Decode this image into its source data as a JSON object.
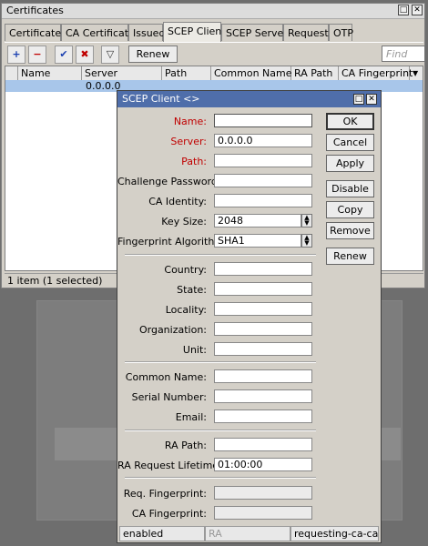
{
  "window": {
    "title": "Certificates",
    "tabs": [
      "Certificates",
      "CA Certificates",
      "Issued",
      "SCEP Clients",
      "SCEP Servers",
      "Requests",
      "OTP"
    ],
    "active_tab": "SCEP Clients",
    "toolbar": {
      "add_icon": "plus-icon",
      "remove_icon": "minus-icon",
      "enable_icon": "check-icon",
      "disable_icon": "x-icon",
      "filter_icon": "filter-icon",
      "renew_label": "Renew",
      "find_placeholder": "Find"
    },
    "columns": [
      "Name",
      "Server",
      "Path",
      "Common Name",
      "RA Path",
      "CA Fingerprint"
    ],
    "rows": [
      {
        "name": "",
        "server": "0.0.0.0",
        "path": "",
        "common_name": "",
        "ra_path": "",
        "ca_fingerprint": ""
      }
    ],
    "status": "1 item (1 selected)"
  },
  "dialog": {
    "title": "SCEP Client <>",
    "fields": {
      "name": {
        "label": "Name:",
        "value": ""
      },
      "server": {
        "label": "Server:",
        "value": "0.0.0.0"
      },
      "path": {
        "label": "Path:",
        "value": ""
      },
      "challenge_password": {
        "label": "Challenge Password:",
        "value": ""
      },
      "ca_identity": {
        "label": "CA Identity:",
        "value": ""
      },
      "key_size": {
        "label": "Key Size:",
        "value": "2048"
      },
      "fingerprint_algorithm": {
        "label": "Fingerprint Algorithm:",
        "value": "SHA1"
      },
      "country": {
        "label": "Country:",
        "value": ""
      },
      "state": {
        "label": "State:",
        "value": ""
      },
      "locality": {
        "label": "Locality:",
        "value": ""
      },
      "organization": {
        "label": "Organization:",
        "value": ""
      },
      "unit": {
        "label": "Unit:",
        "value": ""
      },
      "common_name": {
        "label": "Common Name:",
        "value": ""
      },
      "serial_number": {
        "label": "Serial Number:",
        "value": ""
      },
      "email": {
        "label": "Email:",
        "value": ""
      },
      "ra_path": {
        "label": "RA Path:",
        "value": ""
      },
      "ra_request_lifetime": {
        "label": "RA Request Lifetime:",
        "value": "01:00:00"
      },
      "req_fingerprint": {
        "label": "Req. Fingerprint:",
        "value": ""
      },
      "ca_fingerprint": {
        "label": "CA Fingerprint:",
        "value": ""
      }
    },
    "buttons": {
      "ok": "OK",
      "cancel": "Cancel",
      "apply": "Apply",
      "disable": "Disable",
      "copy": "Copy",
      "remove": "Remove",
      "renew": "Renew"
    },
    "status": {
      "state": "enabled",
      "ra": "RA",
      "progress": "requesting-ca-capa..."
    }
  }
}
